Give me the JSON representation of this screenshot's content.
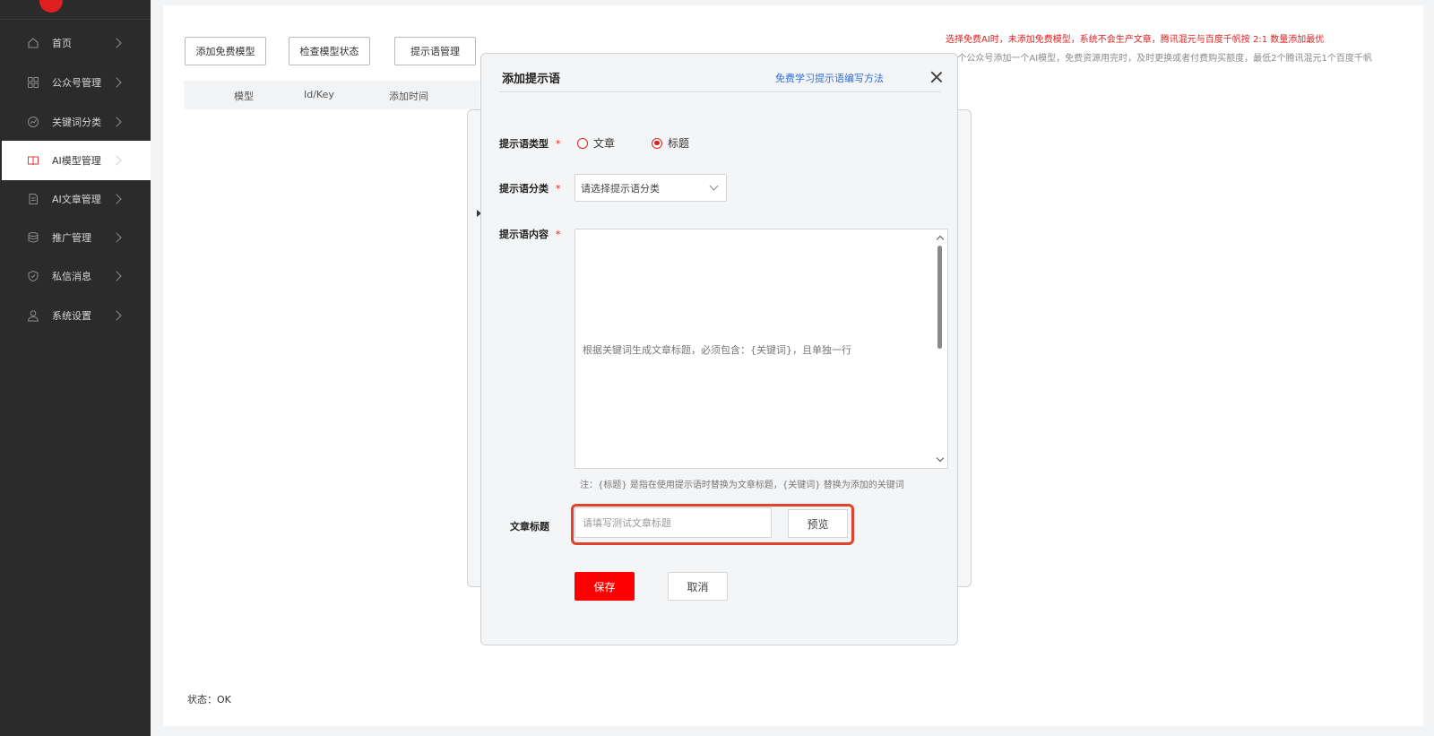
{
  "sidebar": {
    "items": [
      {
        "label": "首页",
        "icon": "home-icon"
      },
      {
        "label": "公众号管理",
        "icon": "grid-icon"
      },
      {
        "label": "关键词分类",
        "icon": "chart-icon"
      },
      {
        "label": "AI模型管理",
        "icon": "book-icon",
        "active": true
      },
      {
        "label": "AI文章管理",
        "icon": "document-icon"
      },
      {
        "label": "推广管理",
        "icon": "database-icon"
      },
      {
        "label": "私信消息",
        "icon": "shield-icon"
      },
      {
        "label": "系统设置",
        "icon": "user-icon"
      }
    ]
  },
  "toolbar": {
    "add_free_model": "添加免费模型",
    "check_model_status": "检查模型状态",
    "prompt_management": "提示语管理"
  },
  "table": {
    "headers": [
      "模型",
      "Id/Key",
      "添加时间"
    ]
  },
  "notices": {
    "warning": "选择免费AI时，未添加免费模型，系统不会生产文章，腾讯混元与百度千帆按 2:1 数量添加最优",
    "info": "5个公众号添加一个AI模型，免费资源用完时，及时更换或者付费购买额度，最低2个腾讯混元1个百度千帆"
  },
  "status_text": "状态：OK",
  "dialog": {
    "title": "添加提示语",
    "help_link": "免费学习提示语编写方法",
    "type_label": "提示语类型",
    "type_options": [
      "文章",
      "标题"
    ],
    "type_selected": "标题",
    "required_mark": "*",
    "category_label": "提示语分类",
    "category_placeholder": "请选择提示语分类",
    "content_label": "提示语内容",
    "content_value": "根据关键词生成文章标题，必须包含：{关键词}，且单独一行",
    "note": "注：{标题} 是指在使用提示语时替换为文章标题，{关键词} 替换为添加的关键词",
    "article_title_label": "文章标题",
    "article_title_placeholder": "请填写测试文章标题",
    "preview_button": "预览",
    "save_button": "保存",
    "cancel_button": "取消"
  },
  "colors": {
    "accent": "#ff0000",
    "link": "#2f6fd6",
    "sidebar_bg": "#2b2b2b",
    "highlight_box": "#e0422b"
  }
}
